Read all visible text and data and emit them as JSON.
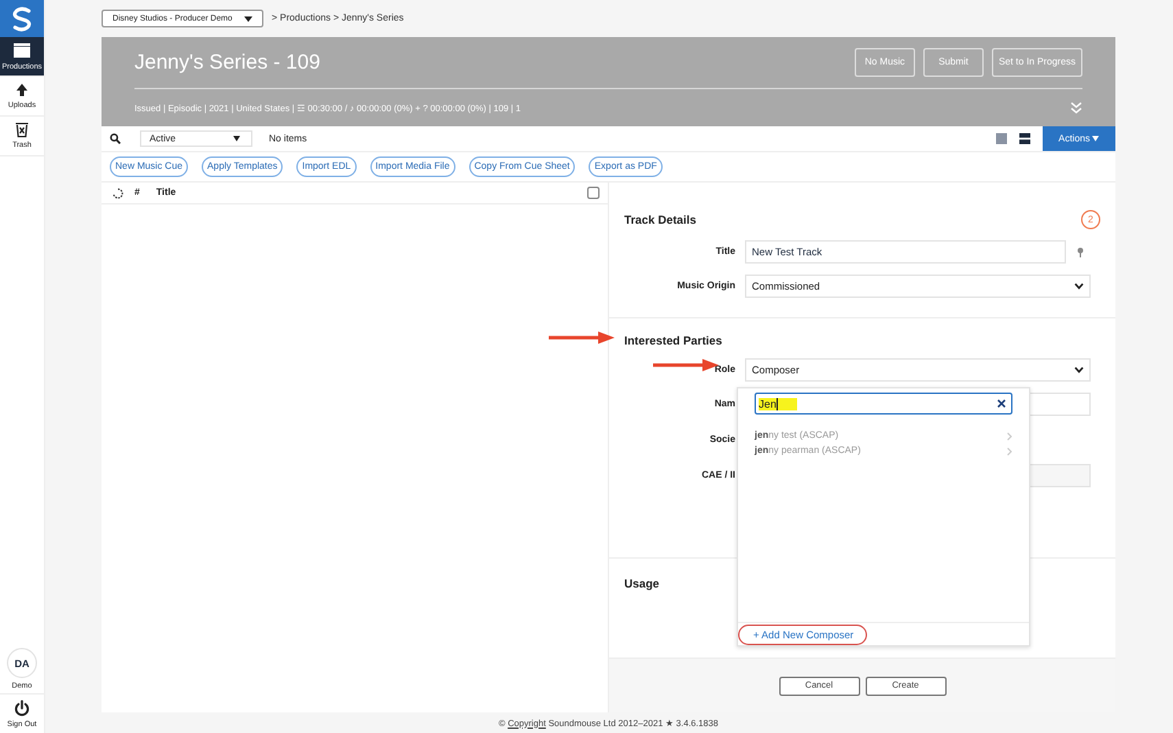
{
  "sidebar": {
    "items": [
      {
        "label": "Productions",
        "kind": "clapper",
        "selected": true
      },
      {
        "label": "Uploads",
        "kind": "upload",
        "selected": false
      },
      {
        "label": "Trash",
        "kind": "trash",
        "selected": false
      }
    ],
    "user": {
      "initials": "DA",
      "name": "Demo"
    },
    "sign_out": "Sign Out"
  },
  "top_bar": {
    "organization": "Disney Studios - Producer Demo",
    "breadcrumb": "> Productions > Jenny's Series"
  },
  "header": {
    "title": "Jenny's Series - 109",
    "buttons": [
      "No Music",
      "Submit",
      "Set to In Progress"
    ],
    "meta": "Issued | Episodic | 2021 | United States | ☲ 00:30:00 / ♪ 00:00:00 (0%) + ? 00:00:00 (0%) | 109 | 1"
  },
  "toolbar": {
    "filter": "Active",
    "status": "No items",
    "view_toggle": [
      {
        "kind": "grid",
        "selected": false
      },
      {
        "kind": "list",
        "selected": true
      }
    ],
    "actions": "Actions"
  },
  "action_buttons": [
    "New Music Cue",
    "Apply Templates",
    "Import EDL",
    "Import Media File",
    "Copy From Cue Sheet",
    "Export as PDF"
  ],
  "table": {
    "columns": [
      "#",
      "Title"
    ],
    "select_all": false
  },
  "form": {
    "badge": "2",
    "track_details": {
      "heading": "Track Details",
      "fields": [
        {
          "label": "Title",
          "value": "New Test Track",
          "kind": "text"
        },
        {
          "label": "Music Origin",
          "value": "Commissioned",
          "kind": "select"
        }
      ]
    },
    "interested_parties": {
      "heading": "Interested Parties",
      "fields": [
        {
          "label": "Role",
          "value": "Composer",
          "kind": "select"
        },
        {
          "label": "Nam",
          "kind": "text"
        },
        {
          "label": "Socie",
          "kind": "none"
        },
        {
          "label": "CAE / II",
          "kind": "readonly"
        }
      ]
    },
    "usage": {
      "heading": "Usage"
    },
    "buttons": [
      "Cancel",
      "Create"
    ]
  },
  "dropdown": {
    "query": "Jen",
    "results": [
      "**jen**ny test (ASCAP)",
      "**jen**ny pearman (ASCAP)"
    ],
    "add_link": "+ Add New Composer"
  },
  "footer": {
    "prefix": "© ",
    "link": "Copyright",
    "text": " Soundmouse Ltd 2012–2021 ★ 3.4.6.1838"
  }
}
